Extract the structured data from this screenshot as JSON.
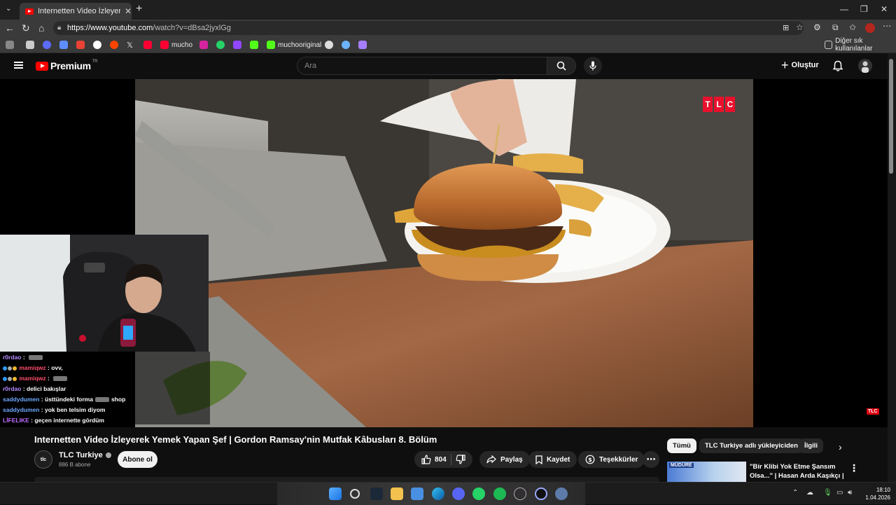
{
  "browser": {
    "tab_title": "Internetten Video İzleyerek Yemek",
    "url_host": "https://www.youtube.com",
    "url_path": "/watch?v=dBsa2jyxlGg",
    "bookmarks": [
      {
        "label": "mucho",
        "color": "#ff0033"
      },
      {
        "label": "muchooriginal",
        "color": "#53fc18"
      }
    ],
    "other_bookmarks": "Diğer sık kullanılanlar"
  },
  "youtube": {
    "brand": "Premium",
    "region": "TR",
    "search_placeholder": "Ara",
    "create_label": "Oluştur"
  },
  "video": {
    "title": "Internetten Video İzleyerek Yemek Yapan Şef | Gordon Ramsay'nin Mutfak Kâbusları 8. Bölüm",
    "watermark": [
      "T",
      "L",
      "C"
    ],
    "watermark_small": "TLC",
    "channel": {
      "name": "TLC Turkiye",
      "avatar_text": "tlc",
      "subscribers": "886 B abone",
      "subscribe_label": "Abone ol"
    },
    "actions": {
      "likes": "804",
      "share": "Paylaş",
      "save": "Kaydet",
      "thanks": "Teşekkürler"
    }
  },
  "chat": [
    {
      "user": "r0rdao",
      "color": "#b58cff",
      "msg": "",
      "emote": true,
      "badges": false
    },
    {
      "user": "mamiqwz",
      "color": "#ff4d6d",
      "msg": "ovv,",
      "emote": false,
      "badges": true
    },
    {
      "user": "mamiqwz",
      "color": "#ff4d6d",
      "msg": "",
      "emote": true,
      "badges": true
    },
    {
      "user": "r0rdao",
      "color": "#b58cff",
      "msg": "delici bakışlar",
      "emote": false,
      "badges": false
    },
    {
      "user": "saddydumen",
      "color": "#6fa8ff",
      "msg": "üsttündeki forma",
      "emote": true,
      "after": "shop",
      "badges": false
    },
    {
      "user": "saddydumen",
      "color": "#6fa8ff",
      "msg": "yok ben telsim diyom",
      "emote": false,
      "badges": false
    },
    {
      "user": "LİFELIKE",
      "color": "#c06cff",
      "msg": "geçen internette gördüm",
      "emote": false,
      "badges": false
    }
  ],
  "sidebar": {
    "chips": [
      "Tümü",
      "TLC Turkiye adlı yükleyiciden",
      "İlgili"
    ],
    "rec": {
      "thumb_label": "MÜDÜRE",
      "title": "\"Bir Klibi Yok Etme Şansım Olsa...\" | Hasan Arda Kaşıkçı | ..."
    }
  },
  "taskbar": {
    "time": "18:10",
    "date": "1.04.2026"
  }
}
